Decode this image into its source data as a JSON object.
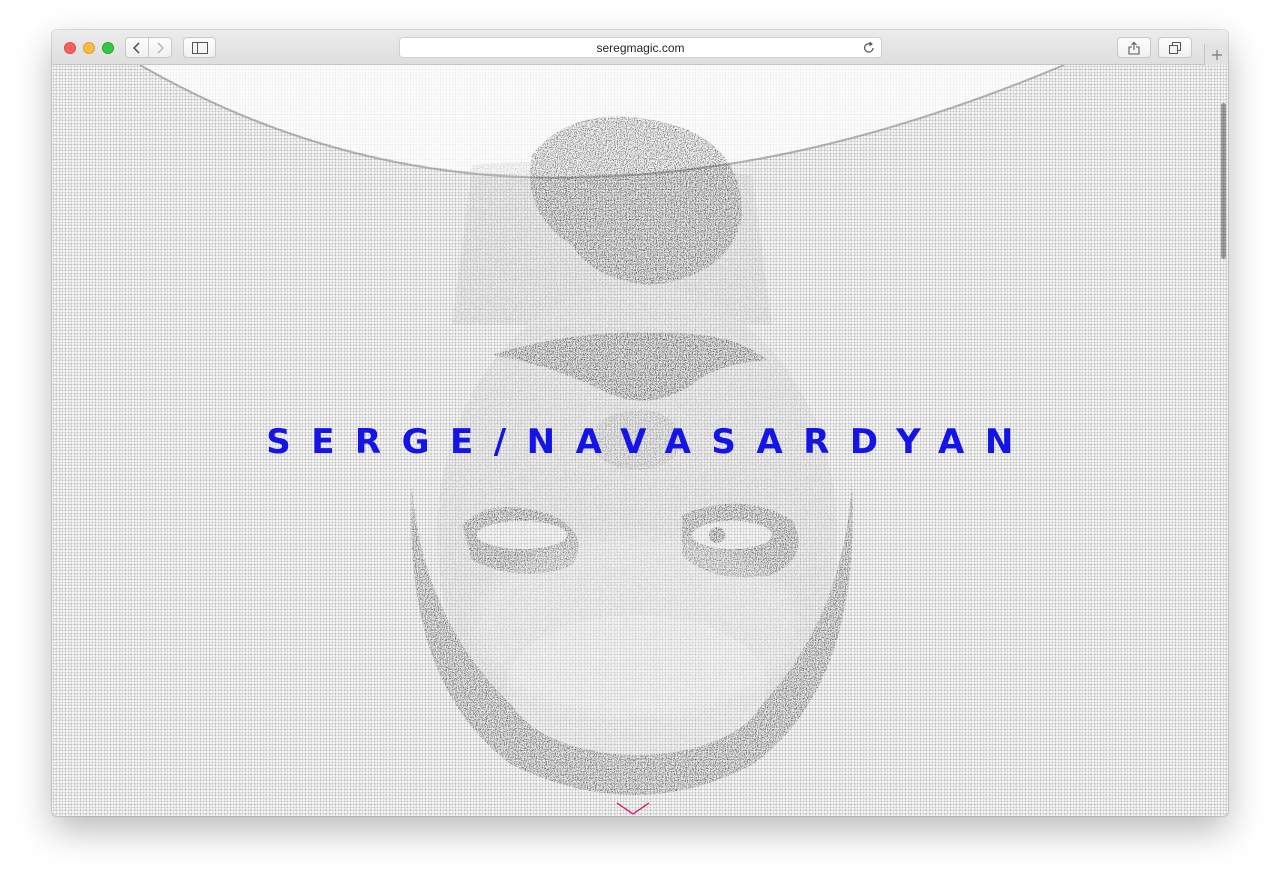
{
  "browser": {
    "url": "seregmagic.com",
    "traffic_lights": {
      "close": "#fc605c",
      "minimize": "#fdbc40",
      "zoom": "#34c84a"
    },
    "icons": [
      "back-icon",
      "forward-icon",
      "sidebar-icon",
      "reload-icon",
      "share-icon",
      "tabs-icon",
      "plus-icon"
    ]
  },
  "hero": {
    "name": "SERGE/NAVASARDYAN",
    "name_color": "#1414e6",
    "scroll_icon": "chevron-down-icon",
    "scroll_icon_color": "#d6287a"
  }
}
